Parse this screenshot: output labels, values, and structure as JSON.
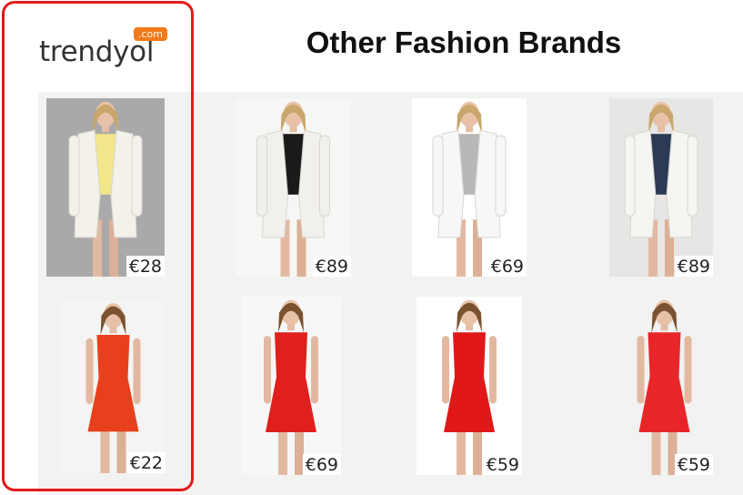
{
  "brand": {
    "logo_word": "trendyol",
    "logo_badge": ".com",
    "logo_color": "#f27a1a",
    "highlight_color": "#e41a1a"
  },
  "page": {
    "title": "Other Fashion Brands"
  },
  "products": [
    {
      "row": "blazers",
      "brand": "trendyol",
      "price": "€28",
      "garment": "white-blazer",
      "garment_color": "#f3f1ea",
      "top_color": "#f1e68a"
    },
    {
      "row": "blazers",
      "brand": "other",
      "price": "€89",
      "garment": "white-blazer",
      "garment_color": "#f1f0ec",
      "top_color": "#1a1a1a"
    },
    {
      "row": "blazers",
      "brand": "other",
      "price": "€69",
      "garment": "white-blazer",
      "garment_color": "#f7f7f7",
      "top_color": "#b8b8b8"
    },
    {
      "row": "blazers",
      "brand": "other",
      "price": "€89",
      "garment": "white-blazer",
      "garment_color": "#f5f5f2",
      "top_color": "#2b3a55"
    },
    {
      "row": "red-dresses",
      "brand": "trendyol",
      "price": "€22",
      "garment": "red-dress",
      "garment_color": "#e8401c"
    },
    {
      "row": "red-dresses",
      "brand": "other",
      "price": "€69",
      "garment": "red-dress",
      "garment_color": "#e0201c"
    },
    {
      "row": "red-dresses",
      "brand": "other",
      "price": "€59",
      "garment": "red-dress",
      "garment_color": "#e01818"
    },
    {
      "row": "red-dresses",
      "brand": "other",
      "price": "€59",
      "garment": "red-dress",
      "garment_color": "#e8262a"
    }
  ]
}
